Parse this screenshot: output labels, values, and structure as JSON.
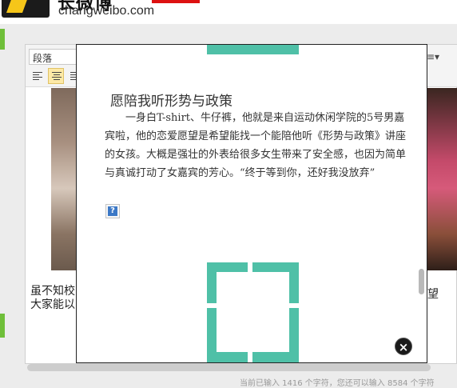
{
  "site": {
    "domain": "changweibo.com",
    "brand_text": "长微博"
  },
  "toolbar": {
    "paragraph_select": "段落",
    "right_icon": "≡▾"
  },
  "background_text": {
    "left_line1": "虽不知校",
    "left_line2": "大家能以",
    "right_line1": "望"
  },
  "status": {
    "text": "当前已输入 1416 个字符，您还可以输入 8584 个字符"
  },
  "dialog": {
    "title": "愿陪我听形势与政策",
    "body": "一身白T-shirt、牛仔裤，他就是来自运动休闲学院的5号男嘉宾啦，他的恋爱愿望是希望能找一个能陪他听《形势与政策》讲座的女孩。大概是强壮的外表给很多女生带来了安全感，也因为简单与真诚打动了女嘉宾的芳心。“终于等到你，还好我没放弃”",
    "help_glyph": "?",
    "close_glyph": "×"
  },
  "colors": {
    "accent_teal": "#4fc0a7",
    "green_strip": "#6fbf3a",
    "logo_yellow": "#f6c619",
    "help_blue": "#3b78c6"
  },
  "icons": {
    "align_left": "align-left-icon",
    "align_center": "align-center-icon",
    "align_right": "align-right-icon",
    "help": "help-icon",
    "close": "close-icon"
  }
}
